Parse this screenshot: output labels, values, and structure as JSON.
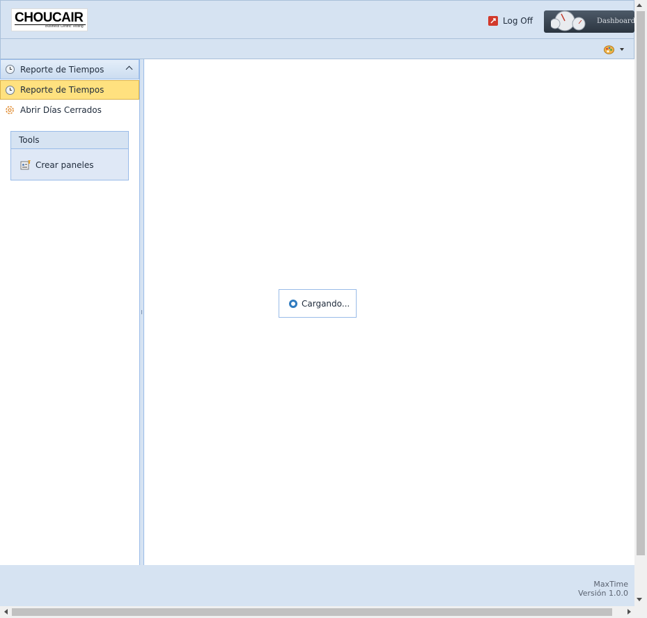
{
  "header": {
    "logo": {
      "name": "CHOUCAIR",
      "tagline": "Business Centric Testing"
    },
    "logoff_label": "Log Off",
    "dashboard_label": "Dashboard"
  },
  "toolbar": {
    "theme_icon": "palette-icon"
  },
  "sidebar": {
    "section_title": "Reporte de Tiempos",
    "items": [
      {
        "label": "Reporte de Tiempos",
        "icon": "clock-icon",
        "selected": true
      },
      {
        "label": "Abrir Días Cerrados",
        "icon": "gear-icon",
        "selected": false
      }
    ],
    "tools": {
      "title": "Tools",
      "items": [
        {
          "label": "Crear paneles",
          "icon": "panel-add-icon"
        }
      ]
    }
  },
  "main": {
    "loading_text": "Cargando..."
  },
  "footer": {
    "app_name": "MaxTime",
    "version": "Versión 1.0.0"
  },
  "colors": {
    "accent": "#d6e3f2",
    "selected": "#ffe17f",
    "border": "#99bbe8"
  }
}
